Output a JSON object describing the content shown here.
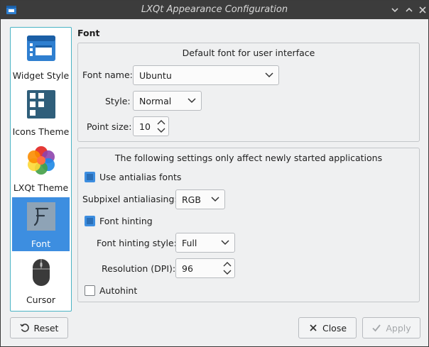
{
  "window": {
    "title": "LXQt Appearance Configuration"
  },
  "sidebar": {
    "items": [
      {
        "label": "Widget Style",
        "icon": "widget-style-icon"
      },
      {
        "label": "Icons Theme",
        "icon": "icons-theme-icon"
      },
      {
        "label": "LXQt Theme",
        "icon": "lxqt-theme-icon"
      },
      {
        "label": "Font",
        "icon": "font-icon",
        "active": true
      },
      {
        "label": "Cursor",
        "icon": "mouse-cursor-icon"
      }
    ]
  },
  "font_page": {
    "section_title": "Font",
    "default_group": {
      "title": "Default font for user interface",
      "font_name_label": "Font name:",
      "font_name_value": "Ubuntu",
      "style_label": "Style:",
      "style_value": "Normal",
      "point_size_label": "Point size:",
      "point_size_value": "10"
    },
    "newapps_group": {
      "title": "The following settings only affect newly started applications",
      "antialias_label": "Use antialias fonts",
      "antialias_checked": true,
      "subpixel_label": "Subpixel antialiasing:",
      "subpixel_value": "RGB",
      "hinting_label": "Font hinting",
      "hinting_checked": true,
      "hinting_style_label": "Font hinting style:",
      "hinting_style_value": "Full",
      "resolution_label": "Resolution (DPI):",
      "resolution_value": "96",
      "autohint_label": "Autohint",
      "autohint_checked": false
    }
  },
  "buttons": {
    "reset": "Reset",
    "close": "Close",
    "apply": "Apply"
  },
  "colors": {
    "accent": "#3d8ee0",
    "titlebar": "#3c3c3c",
    "sidebar_border": "#4ab3c4"
  }
}
